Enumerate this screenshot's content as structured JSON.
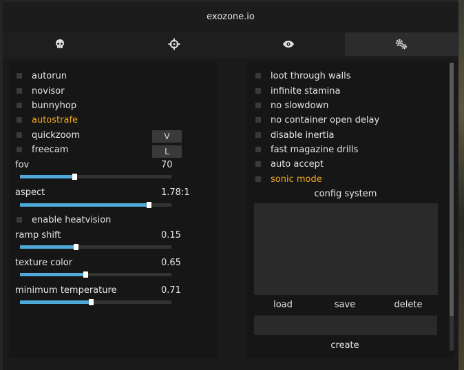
{
  "window": {
    "title": "exozone.io"
  },
  "tabs": [
    {
      "icon": "skull-icon"
    },
    {
      "icon": "crosshair-icon"
    },
    {
      "icon": "eye-icon"
    },
    {
      "icon": "gears-icon"
    }
  ],
  "left": {
    "toggles": [
      {
        "label": "autorun"
      },
      {
        "label": "novisor"
      },
      {
        "label": "bunnyhop"
      },
      {
        "label": "autostrafe"
      },
      {
        "label": "quickzoom",
        "key": "V"
      },
      {
        "label": "freecam",
        "key": "L"
      }
    ],
    "fov": {
      "label": "fov",
      "value": "70",
      "fraction": 0.36
    },
    "aspect": {
      "label": "aspect",
      "value": "1.78:1",
      "fraction": 0.85
    },
    "heatvision": {
      "label": "enable heatvision"
    },
    "ramp_shift": {
      "label": "ramp shift",
      "value": "0.15",
      "fraction": 0.37
    },
    "texture_color": {
      "label": "texture color",
      "value": "0.65",
      "fraction": 0.43
    },
    "min_temp": {
      "label": "minimum temperature",
      "value": "0.71",
      "fraction": 0.47
    }
  },
  "right": {
    "toggles": [
      {
        "label": "loot through walls"
      },
      {
        "label": "infinite stamina"
      },
      {
        "label": "no slowdown"
      },
      {
        "label": "no container open delay"
      },
      {
        "label": "disable inertia"
      },
      {
        "label": "fast magazine drills"
      },
      {
        "label": "auto accept"
      },
      {
        "label": "sonic mode"
      }
    ],
    "config": {
      "title": "config system",
      "load": "load",
      "save": "save",
      "delete": "delete",
      "create": "create",
      "name_value": ""
    }
  },
  "colors": {
    "accent": "#f0a81c",
    "slider": "#4fa9d9"
  }
}
